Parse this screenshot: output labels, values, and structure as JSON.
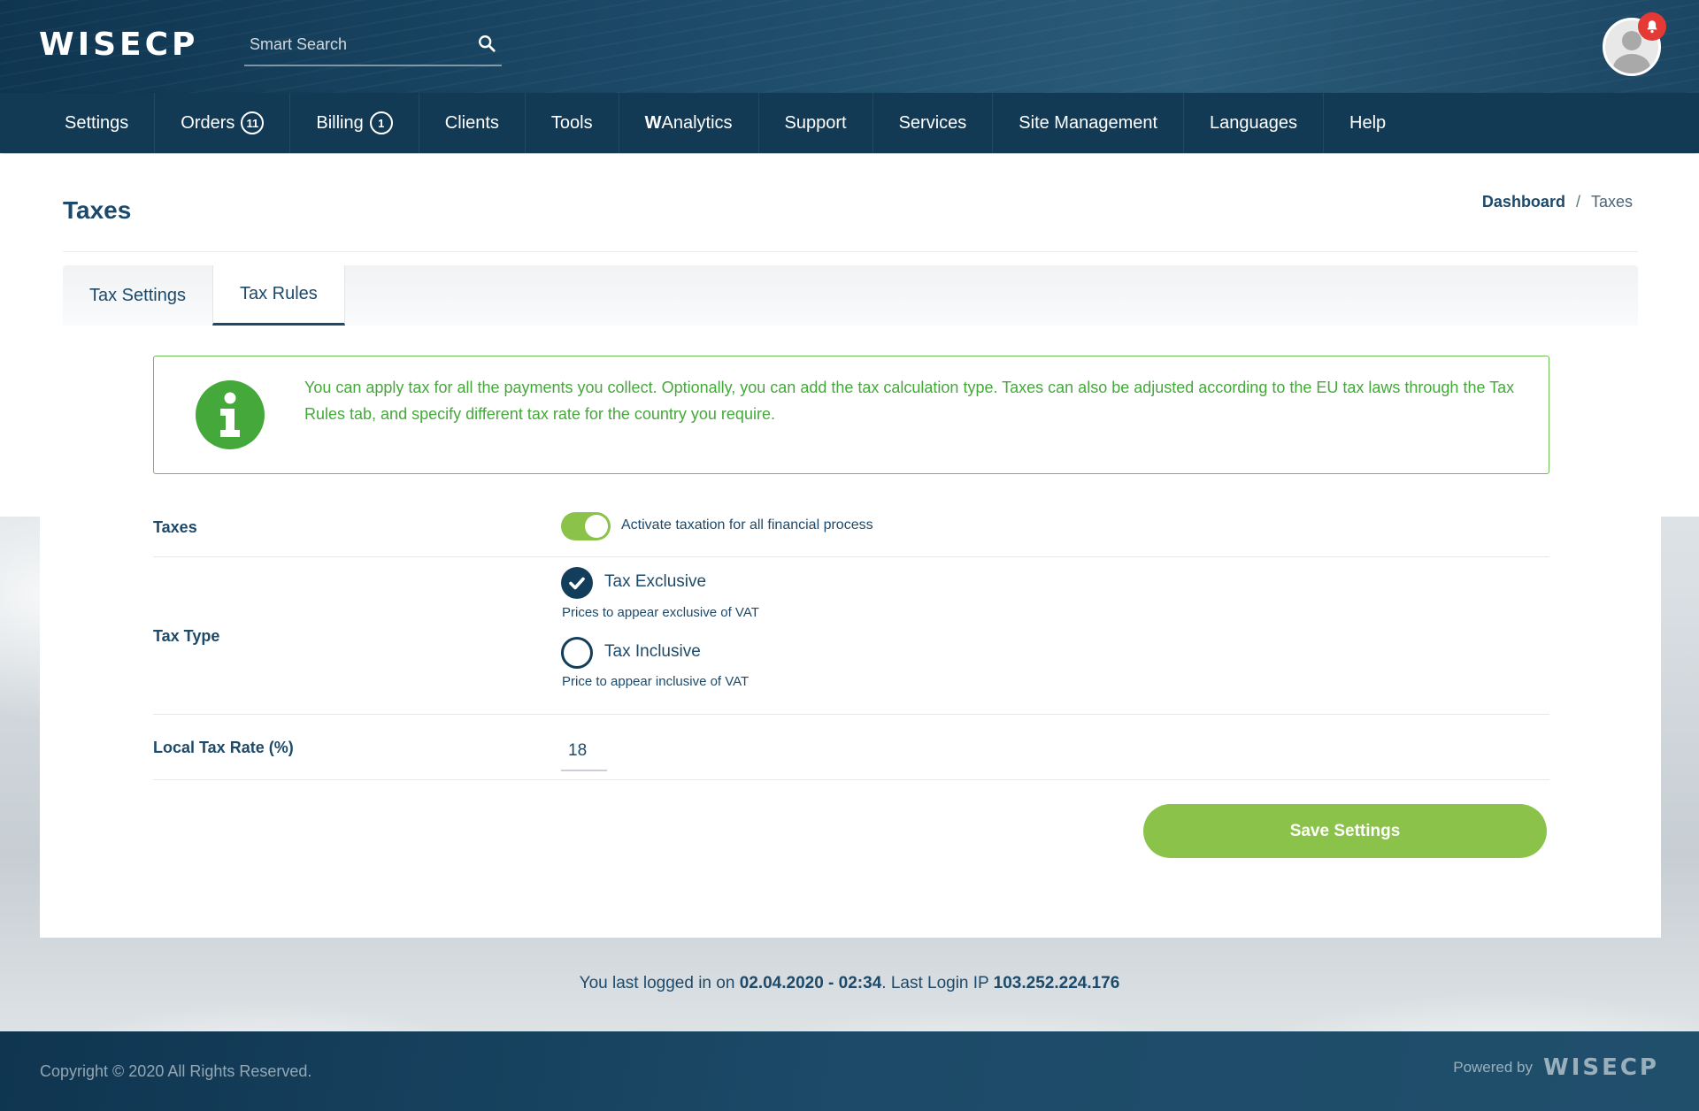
{
  "header": {
    "logo": "WISECP",
    "search": {
      "placeholder": "Smart Search",
      "value": ""
    }
  },
  "nav": {
    "items": [
      {
        "label": "Settings",
        "badge": ""
      },
      {
        "label": "Orders",
        "badge": "11"
      },
      {
        "label": "Billing",
        "badge": "1"
      },
      {
        "label": "Clients",
        "badge": ""
      },
      {
        "label": "Tools",
        "badge": ""
      },
      {
        "label_bold": "W",
        "label": "Analytics",
        "badge": ""
      },
      {
        "label": "Support",
        "badge": ""
      },
      {
        "label": "Services",
        "badge": ""
      },
      {
        "label": "Site Management",
        "badge": ""
      },
      {
        "label": "Languages",
        "badge": ""
      },
      {
        "label": "Help",
        "badge": ""
      }
    ]
  },
  "page": {
    "title": "Taxes",
    "breadcrumb": {
      "link": "Dashboard",
      "separator": "/",
      "current": "Taxes"
    },
    "tabs": [
      {
        "label": "Tax Settings",
        "active": false
      },
      {
        "label": "Tax Rules",
        "active": true
      }
    ]
  },
  "info": {
    "text": "You can apply tax for all the payments you collect. Optionally, you can add the tax calculation type. Taxes can also be adjusted according to the EU tax laws through the Tax Rules tab, and specify different tax rate for the country you require.",
    "color": "#45a83a"
  },
  "form": {
    "taxes": {
      "label": "Taxes",
      "toggle_on": true,
      "toggle_label": "Activate taxation for all financial process"
    },
    "tax_type": {
      "label": "Tax Type",
      "options": [
        {
          "label": "Tax Exclusive",
          "hint": "Prices to appear exclusive of VAT",
          "checked": true
        },
        {
          "label": "Tax Inclusive",
          "hint": "Price to appear inclusive of VAT",
          "checked": false
        }
      ]
    },
    "local_tax_rate": {
      "label": "Local Tax Rate (%)",
      "value": "18"
    },
    "save_label": "Save Settings"
  },
  "last_login": {
    "prefix": "You last logged in on",
    "datetime": "02.04.2020 - 02:34",
    "ip_prefix": ". Last Login IP",
    "ip": "103.252.224.176"
  },
  "footer": {
    "copyright": "Copyright © 2020 All Rights Reserved.",
    "powered_by": "Powered by",
    "powered_logo": "WISECP"
  },
  "colors": {
    "accent_green": "#8bc34a",
    "primary_navy": "#133a54",
    "notification_red": "#e53935"
  }
}
